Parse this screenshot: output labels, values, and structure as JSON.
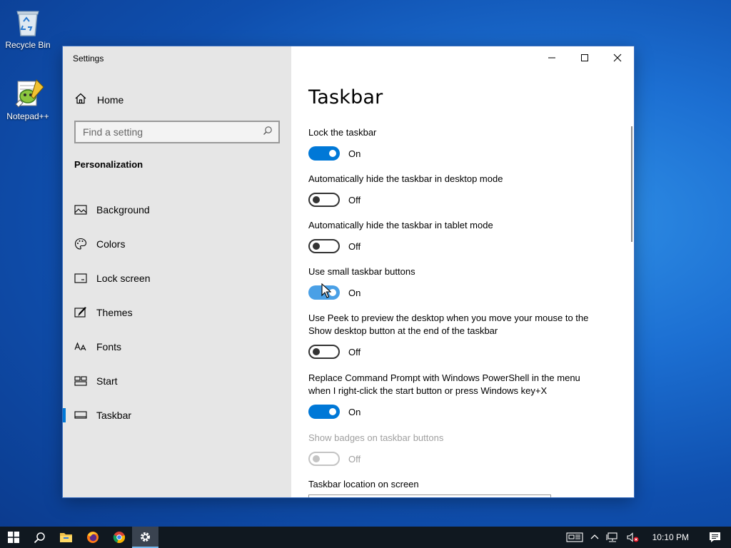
{
  "desktop": {
    "icons": [
      {
        "label": "Recycle Bin",
        "icon": "recycle-bin-icon"
      },
      {
        "label": "Notepad++",
        "icon": "notepad-plus-plus-icon"
      }
    ]
  },
  "window": {
    "app_title": "Settings",
    "sidebar": {
      "home_label": "Home",
      "search_placeholder": "Find a setting",
      "section_heading": "Personalization",
      "items": [
        {
          "label": "Background",
          "icon": "picture-icon"
        },
        {
          "label": "Colors",
          "icon": "palette-icon"
        },
        {
          "label": "Lock screen",
          "icon": "lock-screen-icon"
        },
        {
          "label": "Themes",
          "icon": "brush-icon"
        },
        {
          "label": "Fonts",
          "icon": "font-icon"
        },
        {
          "label": "Start",
          "icon": "start-icon"
        },
        {
          "label": "Taskbar",
          "icon": "taskbar-icon",
          "active": true
        }
      ]
    },
    "content": {
      "page_title": "Taskbar",
      "settings": [
        {
          "label": "Lock the taskbar",
          "state": "On"
        },
        {
          "label": "Automatically hide the taskbar in desktop mode",
          "state": "Off"
        },
        {
          "label": "Automatically hide the taskbar in tablet mode",
          "state": "Off"
        },
        {
          "label": "Use small taskbar buttons",
          "state": "On"
        },
        {
          "label_line1": "Use Peek to preview the desktop when you move your mouse to the",
          "label_line2": "Show desktop button at the end of the taskbar",
          "state": "Off"
        },
        {
          "label_line1": "Replace Command Prompt with Windows PowerShell in the menu",
          "label_line2": "when I right-click the start button or press Windows key+X",
          "state": "On"
        },
        {
          "label": "Show badges on taskbar buttons",
          "state": "Off",
          "disabled": true
        }
      ],
      "location_label": "Taskbar location on screen"
    }
  },
  "taskbar": {
    "apps": [
      "windows-start-icon",
      "search-icon",
      "file-explorer-icon",
      "firefox-icon",
      "chrome-icon",
      "settings-gear-icon"
    ],
    "clock": "10:10 PM"
  },
  "colors": {
    "accent": "#0078d7",
    "sidebar_bg": "#e6e6e6",
    "taskbar_bg": "#101820"
  }
}
